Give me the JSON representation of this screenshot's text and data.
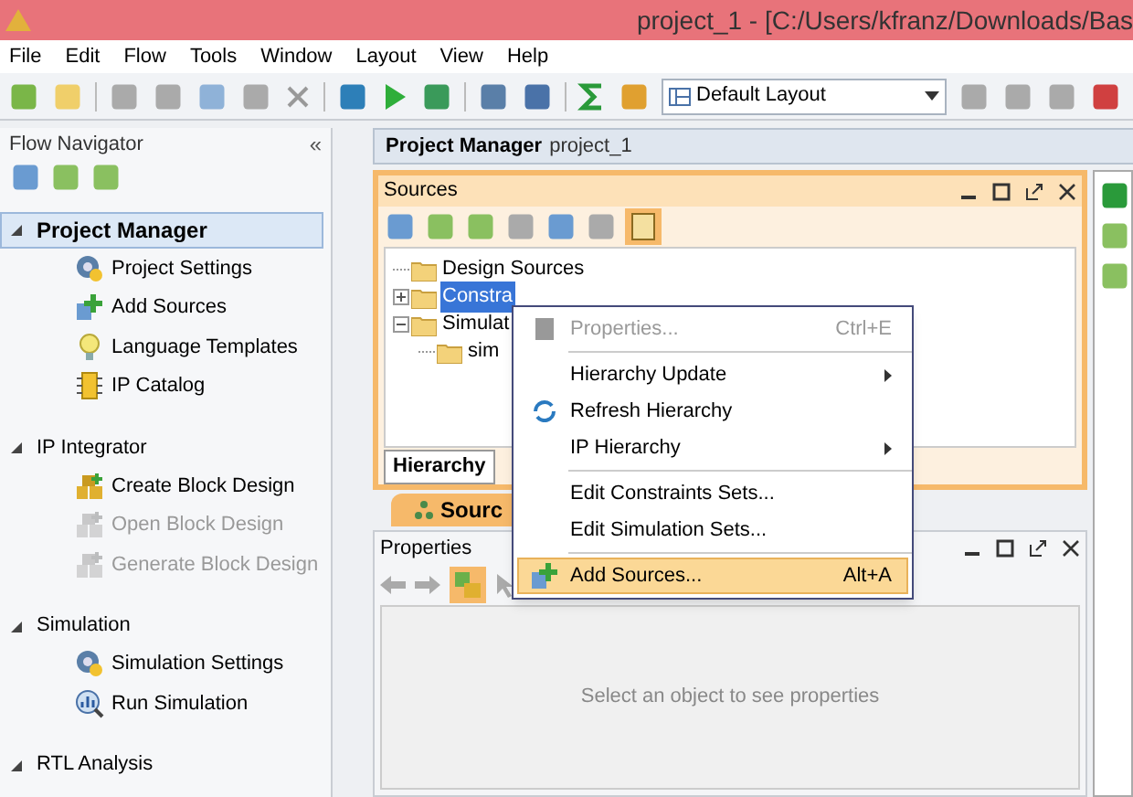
{
  "window": {
    "title": "project_1 - [C:/Users/kfranz/Downloads/Bas"
  },
  "menu": [
    "File",
    "Edit",
    "Flow",
    "Tools",
    "Window",
    "Layout",
    "View",
    "Help"
  ],
  "toolbar": {
    "layout": "Default Layout"
  },
  "flow_navigator": {
    "title": "Flow Navigator",
    "collapse": "«",
    "sections": [
      {
        "title": "Project Manager",
        "expanded": true,
        "selected": true,
        "items": [
          {
            "label": "Project Settings",
            "disabled": false
          },
          {
            "label": "Add Sources",
            "disabled": false
          },
          {
            "label": "Language Templates",
            "disabled": false
          },
          {
            "label": "IP Catalog",
            "disabled": false
          }
        ]
      },
      {
        "title": "IP Integrator",
        "expanded": true,
        "selected": false,
        "items": [
          {
            "label": "Create Block Design",
            "disabled": false
          },
          {
            "label": "Open Block Design",
            "disabled": true
          },
          {
            "label": "Generate Block Design",
            "disabled": true
          }
        ]
      },
      {
        "title": "Simulation",
        "expanded": true,
        "selected": false,
        "items": [
          {
            "label": "Simulation Settings",
            "disabled": false
          },
          {
            "label": "Run Simulation",
            "disabled": false
          }
        ]
      },
      {
        "title": "RTL Analysis",
        "expanded": true,
        "selected": false
      }
    ]
  },
  "project_manager": {
    "title": "Project Manager",
    "project": "project_1"
  },
  "sources": {
    "title": "Sources",
    "tree": [
      {
        "label": "Design Sources",
        "selected": false
      },
      {
        "label": "Constra",
        "selected": true,
        "expanded": false
      },
      {
        "label": "Simulat",
        "selected": false,
        "expanded": true,
        "children": [
          {
            "label": "sim",
            "selected": false
          }
        ]
      }
    ],
    "tabs": [
      {
        "label": "Hierarchy",
        "selected": true
      }
    ],
    "bottom_tab": "Sourc"
  },
  "context_menu": [
    {
      "kind": "item",
      "label": "Properties...",
      "shortcut": "Ctrl+E",
      "disabled": true,
      "submenu": false,
      "selected": false
    },
    {
      "kind": "separator"
    },
    {
      "kind": "item",
      "label": "Hierarchy Update",
      "disabled": false,
      "submenu": true,
      "selected": false
    },
    {
      "kind": "item",
      "label": "Refresh Hierarchy",
      "disabled": false,
      "submenu": false,
      "selected": false
    },
    {
      "kind": "item",
      "label": "IP Hierarchy",
      "disabled": false,
      "submenu": true,
      "selected": false
    },
    {
      "kind": "separator"
    },
    {
      "kind": "item",
      "label": "Edit Constraints Sets...",
      "disabled": false,
      "submenu": false,
      "selected": false
    },
    {
      "kind": "item",
      "label": "Edit Simulation Sets...",
      "disabled": false,
      "submenu": false,
      "selected": false
    },
    {
      "kind": "separator"
    },
    {
      "kind": "item",
      "label": "Add Sources...",
      "shortcut": "Alt+A",
      "disabled": false,
      "submenu": false,
      "selected": true
    }
  ],
  "properties": {
    "title": "Properties",
    "message": "Select an object to see properties"
  }
}
